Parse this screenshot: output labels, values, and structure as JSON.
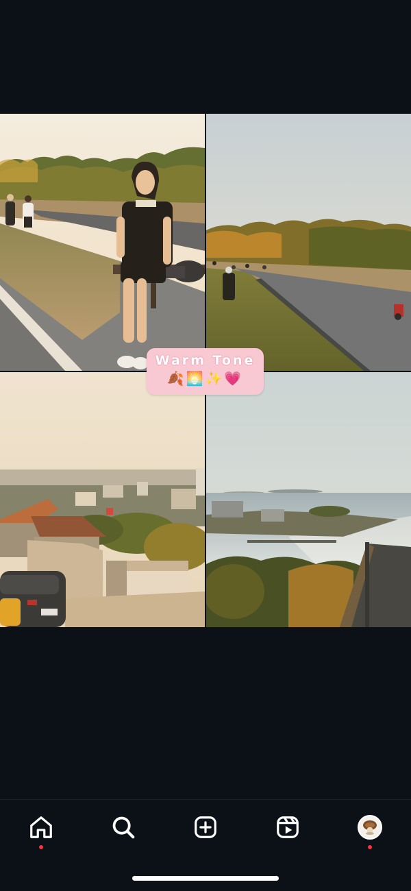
{
  "caption": {
    "title": "Warm Tone",
    "emojis": "🍂🌅✨💗"
  },
  "photos": [
    {
      "name": "photo-girl-sitting-roadside"
    },
    {
      "name": "photo-hill-road-trees"
    },
    {
      "name": "photo-town-rooftops-sea"
    },
    {
      "name": "photo-harbor-sea-view"
    }
  ],
  "nav": {
    "items": [
      {
        "name": "home",
        "icon": "home-icon",
        "notification": true
      },
      {
        "name": "search",
        "icon": "search-icon",
        "notification": false
      },
      {
        "name": "create",
        "icon": "plus-square-icon",
        "notification": false
      },
      {
        "name": "reels",
        "icon": "reels-icon",
        "notification": false
      },
      {
        "name": "profile",
        "icon": "avatar",
        "notification": true
      }
    ]
  },
  "colors": {
    "background": "#0c1118",
    "caption_bg": "#f8c9d3",
    "notification": "#ff3040",
    "icon": "#ffffff"
  }
}
